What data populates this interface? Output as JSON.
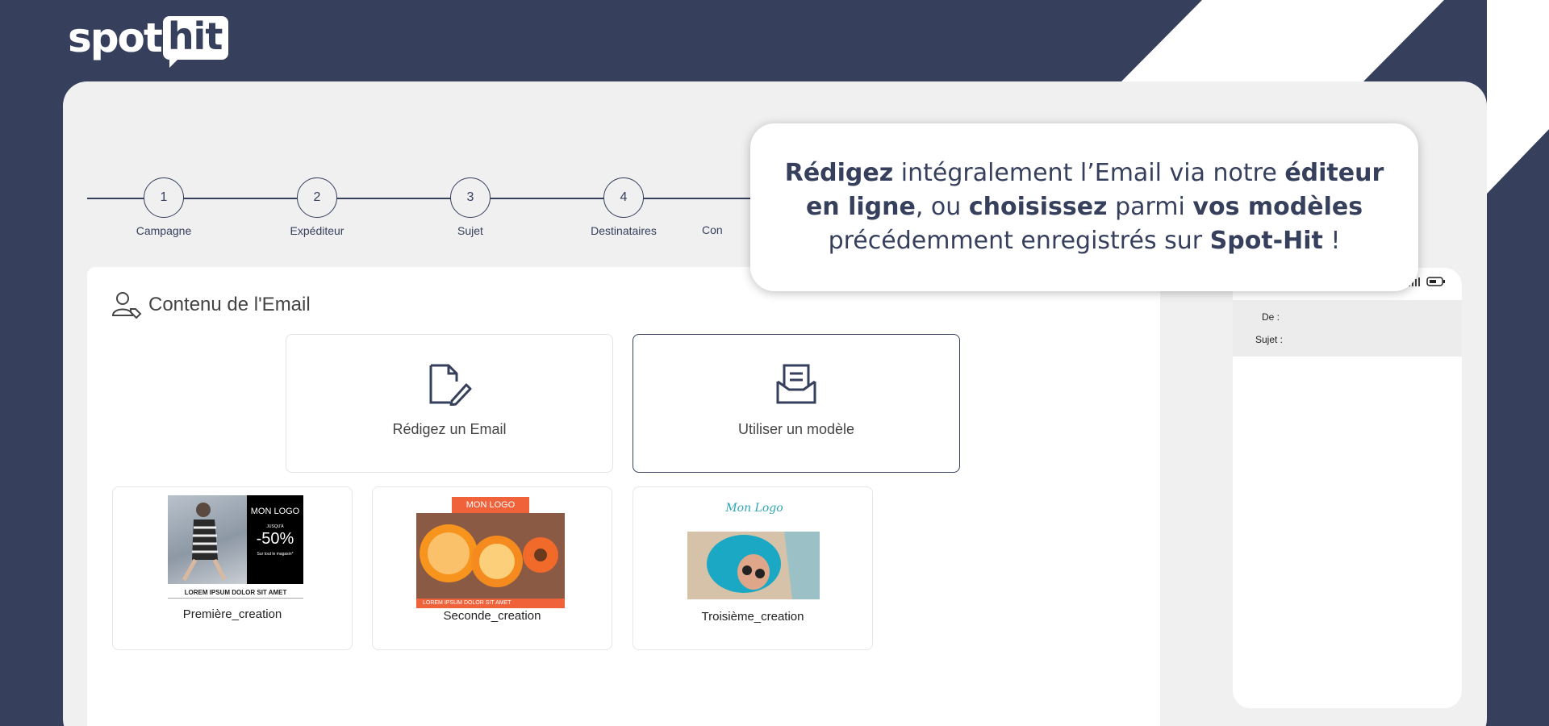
{
  "brand": {
    "logo_spot": "spot",
    "logo_hit": "hit",
    "primary_color": "#363f5c"
  },
  "stepper": [
    {
      "number": "1",
      "label": "Campagne"
    },
    {
      "number": "2",
      "label": "Expéditeur"
    },
    {
      "number": "3",
      "label": "Sujet"
    },
    {
      "number": "4",
      "label": "Destinataires"
    },
    {
      "number": "",
      "label": "Con"
    }
  ],
  "content": {
    "title": "Contenu de l'Email",
    "title_icon": "user-tag-icon",
    "choices": [
      {
        "label": "Rédigez un Email",
        "icon": "file-edit-icon"
      },
      {
        "label": "Utiliser un modèle",
        "icon": "mail-open-icon"
      }
    ],
    "templates": [
      {
        "name": "Première_creation",
        "logo": "MON LOGO",
        "promo_small": "JUSQU'À",
        "promo": "-50%",
        "promo_sub": "Sur tout le magasin*",
        "footer": "LOREM IPSUM DOLOR SIT AMET"
      },
      {
        "name": "Seconde_creation",
        "logo": "MON LOGO",
        "footer": "LOREM IPSUM DOLOR SIT AMET"
      },
      {
        "name": "Troisième_creation",
        "logo": "Mon Logo"
      }
    ]
  },
  "phone": {
    "from_label": "De :",
    "subject_label": "Sujet :"
  },
  "callout": {
    "p1": "Rédigez",
    "p2": " intégralement l’Email via notre ",
    "p3": "éditeur en ligne",
    "p4": ", ou ",
    "p5": "choisissez",
    "p6": " parmi ",
    "p7": "vos modèles",
    "p8": " précédemment enregistrés sur ",
    "p9": "Spot-Hit",
    "p10": " !"
  }
}
